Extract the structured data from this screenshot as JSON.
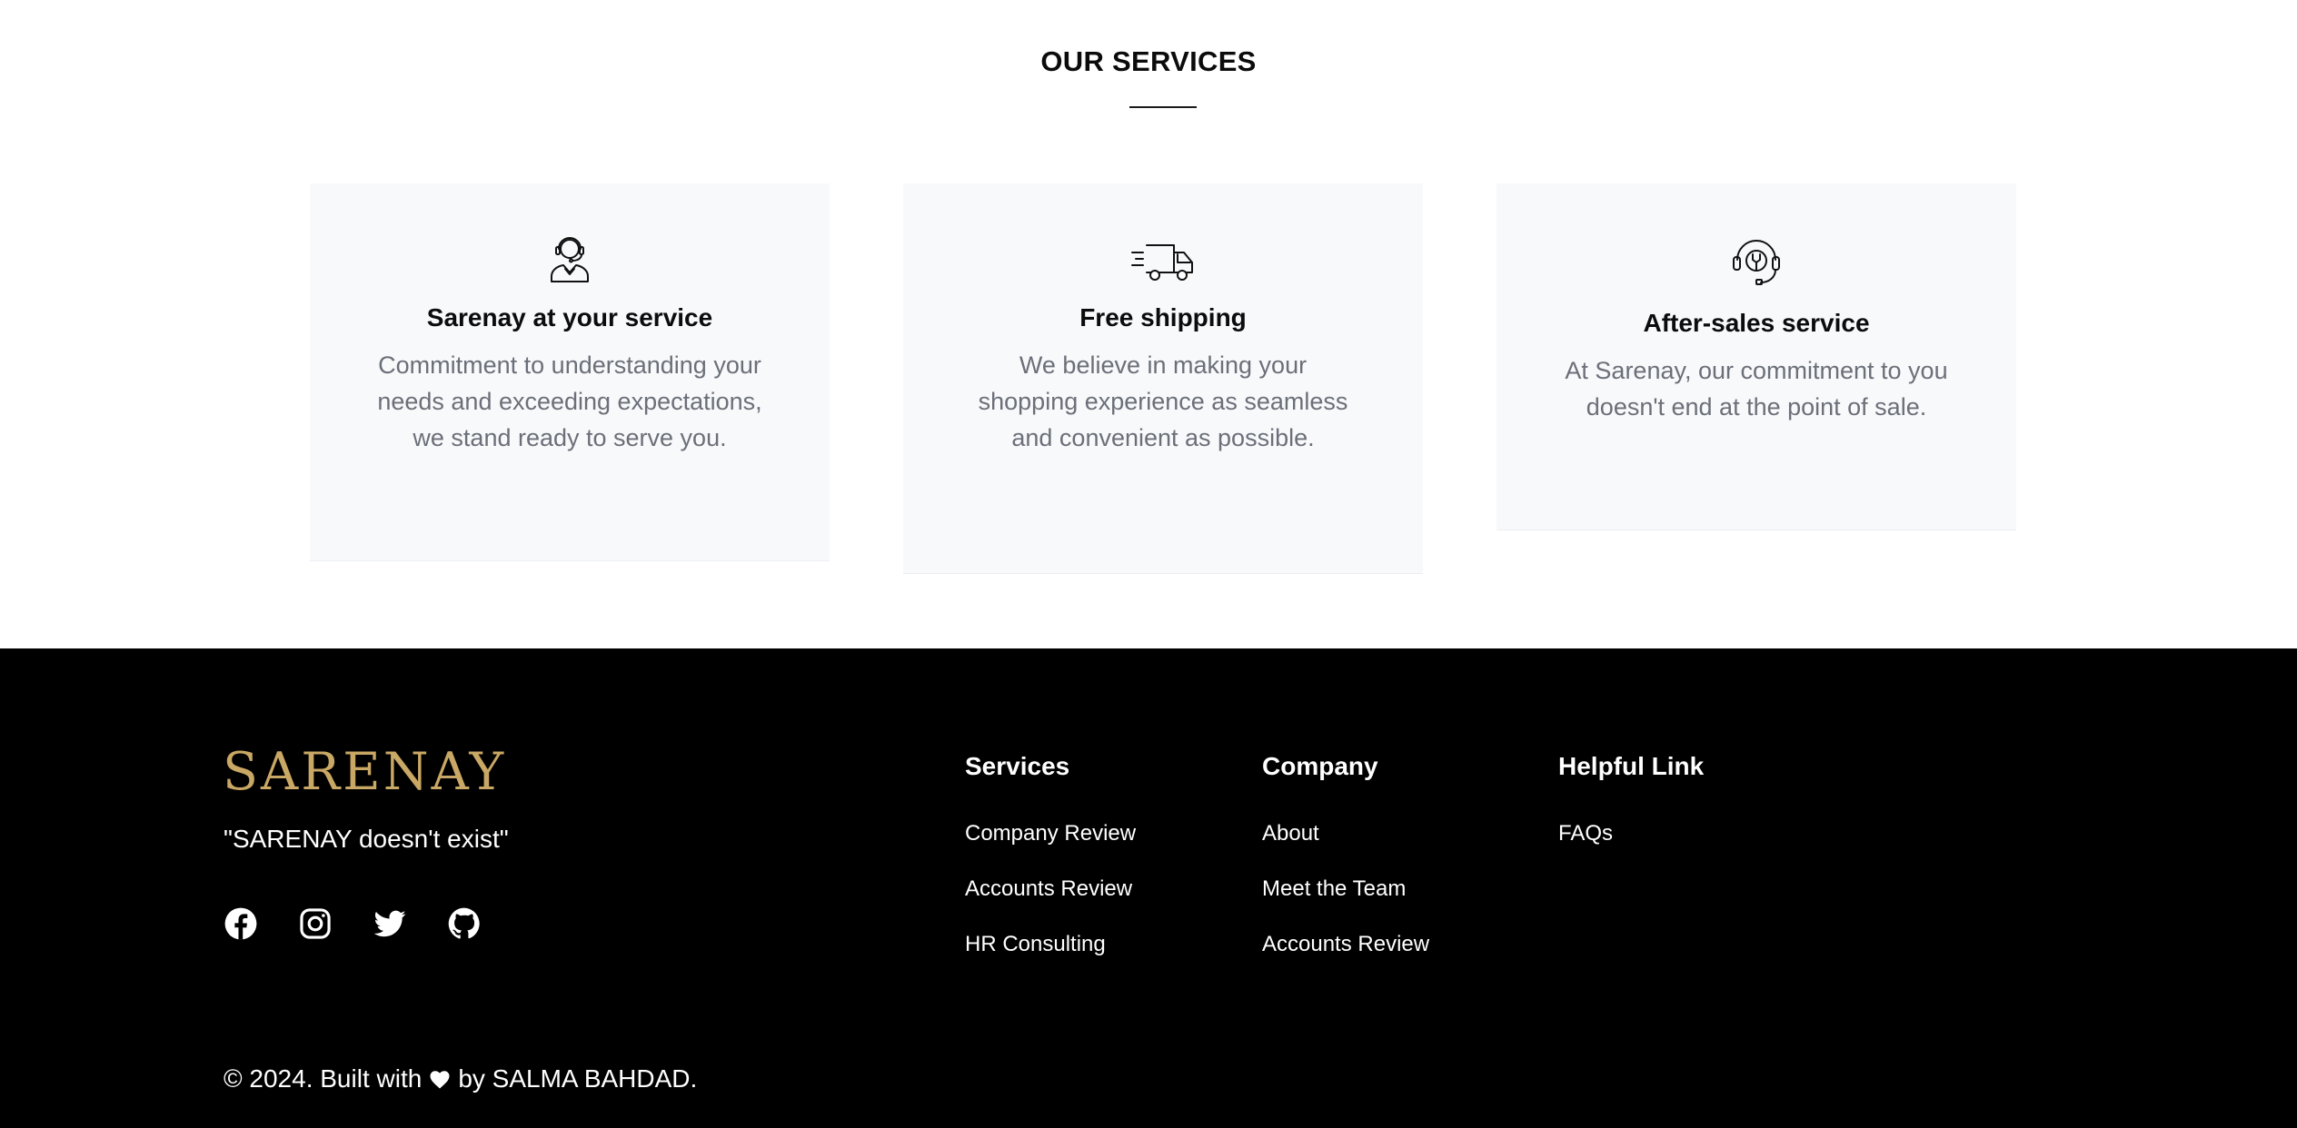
{
  "services": {
    "title": "OUR SERVICES",
    "cards": [
      {
        "icon": "customer-support-agent-icon",
        "title": "Sarenay at your service",
        "text": "Commitment to understanding your needs and exceeding expectations, we stand ready to serve you."
      },
      {
        "icon": "delivery-truck-icon",
        "title": "Free shipping",
        "text": "We believe in making your shopping experience as seamless and convenient as possible."
      },
      {
        "icon": "headset-wrench-icon",
        "title": "After-sales service",
        "text": "At Sarenay, our commitment to you doesn't end at the point of sale."
      }
    ]
  },
  "footer": {
    "brand": "SARENAY",
    "brand_color": "#c9a764",
    "tagline": "\"SARENAY doesn't exist\"",
    "socials": [
      "facebook-icon",
      "instagram-icon",
      "twitter-icon",
      "github-icon"
    ],
    "columns": [
      {
        "title": "Services",
        "links": [
          "Company Review",
          "Accounts Review",
          "HR Consulting"
        ]
      },
      {
        "title": "Company",
        "links": [
          "About",
          "Meet the Team",
          "Accounts Review"
        ]
      },
      {
        "title": "Helpful Link",
        "links": [
          "FAQs"
        ]
      }
    ],
    "copyright_prefix": "© 2024. Built with",
    "copyright_suffix": "by SALMA BAHDAD."
  }
}
